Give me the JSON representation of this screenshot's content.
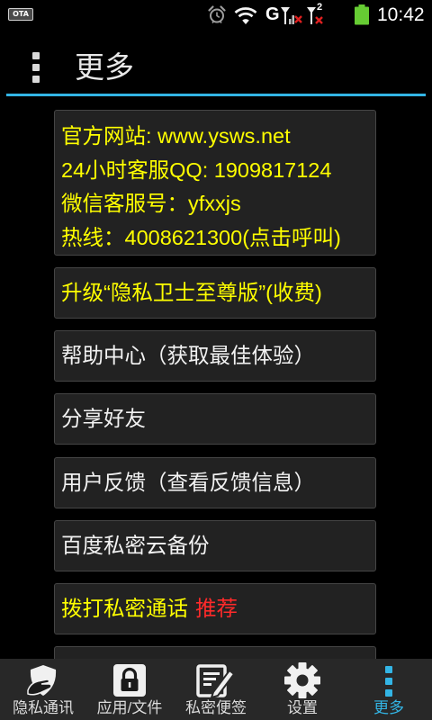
{
  "colors": {
    "background": "#000000",
    "accent": "#33b5e5",
    "highlight_text": "#ffff00",
    "normal_text": "#f2f2f2",
    "badge_text": "#ff2a2a",
    "card_bg": "#222222",
    "card_border": "#454545",
    "tabbar_bg": "#282828",
    "tab_label": "#dcdcdc",
    "icon": "#f0f0f0",
    "battery": "#66cc33",
    "signal_error": "#e02020"
  },
  "status_bar": {
    "ota_label": "OTA",
    "icons": [
      "alarm-icon",
      "wifi-icon",
      "signal-sim1-icon",
      "signal-sim2-icon",
      "battery-icon"
    ],
    "network_type": "G",
    "sim2_label": "2",
    "time": "10:42"
  },
  "action_bar": {
    "menu_icon": "overflow-dots-icon",
    "title": "更多"
  },
  "info_card": {
    "website": "官方网站: www.ysws.net",
    "qq_service": "24小时客服QQ: 1909817124",
    "wechat_service": "微信客服号：yfxxjs",
    "hotline": "热线：4008621300(点击呼叫)"
  },
  "menu_items": [
    {
      "label": "升级“隐私卫士至尊版”(收费)",
      "highlight": true
    },
    {
      "label": "帮助中心（获取最佳体验）",
      "highlight": false
    },
    {
      "label": "分享好友",
      "highlight": false
    },
    {
      "label": "用户反馈（查看反馈信息）",
      "highlight": false
    },
    {
      "label": "百度私密云备份",
      "highlight": false
    },
    {
      "label": "拨打私密通话",
      "highlight": true,
      "badge": "推荐"
    }
  ],
  "tabs": [
    {
      "label": "隐私通讯",
      "icon": "privacy-comm-icon",
      "selected": false
    },
    {
      "label": "应用/文件",
      "icon": "lock-icon",
      "selected": false
    },
    {
      "label": "私密便签",
      "icon": "note-icon",
      "selected": false
    },
    {
      "label": "设置",
      "icon": "gear-icon",
      "selected": false
    },
    {
      "label": "更多",
      "icon": "more-dots-icon",
      "selected": true
    }
  ]
}
